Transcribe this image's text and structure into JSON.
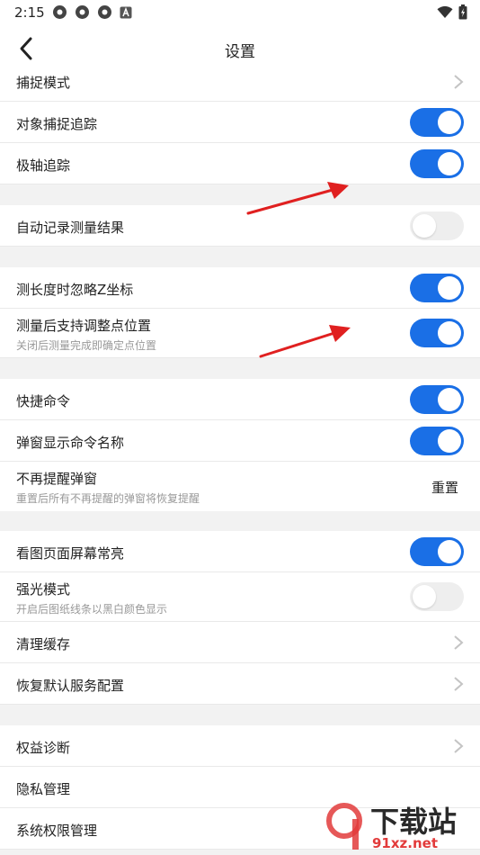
{
  "status_bar": {
    "time": "2:15",
    "icons": [
      "notification-icon",
      "notification-icon",
      "notification-icon",
      "a-icon",
      "wifi-icon",
      "battery-icon"
    ]
  },
  "header": {
    "title": "设置"
  },
  "rows": {
    "capture_mode": "捕捉模式",
    "object_snap": "对象捕捉追踪",
    "polar_tracking": "极轴追踪",
    "auto_record": "自动记录测量结果",
    "ignore_z": "测长度时忽略Z坐标",
    "adjust_point": "测量后支持调整点位置",
    "adjust_point_sub": "关闭后测量完成即确定点位置",
    "shortcut": "快捷命令",
    "popup_name": "弹窗显示命令名称",
    "no_remind": "不再提醒弹窗",
    "no_remind_sub": "重置后所有不再提醒的弹窗将恢复提醒",
    "reset_label": "重置",
    "screen_on": "看图页面屏幕常亮",
    "strong_light": "强光模式",
    "strong_light_sub": "开启后图纸线条以黑白颜色显示",
    "clear_cache": "清理缓存",
    "restore_default": "恢复默认服务配置",
    "rights_diag": "权益诊断",
    "privacy": "隐私管理",
    "sys_perm": "系统权限管理"
  },
  "toggles": {
    "object_snap": true,
    "polar_tracking": true,
    "auto_record": false,
    "ignore_z": true,
    "adjust_point": true,
    "shortcut": true,
    "popup_name": true,
    "screen_on": true,
    "strong_light": false
  },
  "watermark": {
    "brand": "下载站",
    "domain": "91xz.net"
  },
  "colors": {
    "accent": "#1a6fe6",
    "toggle_off": "#eeeeee",
    "annotation_arrow": "#e02020"
  }
}
